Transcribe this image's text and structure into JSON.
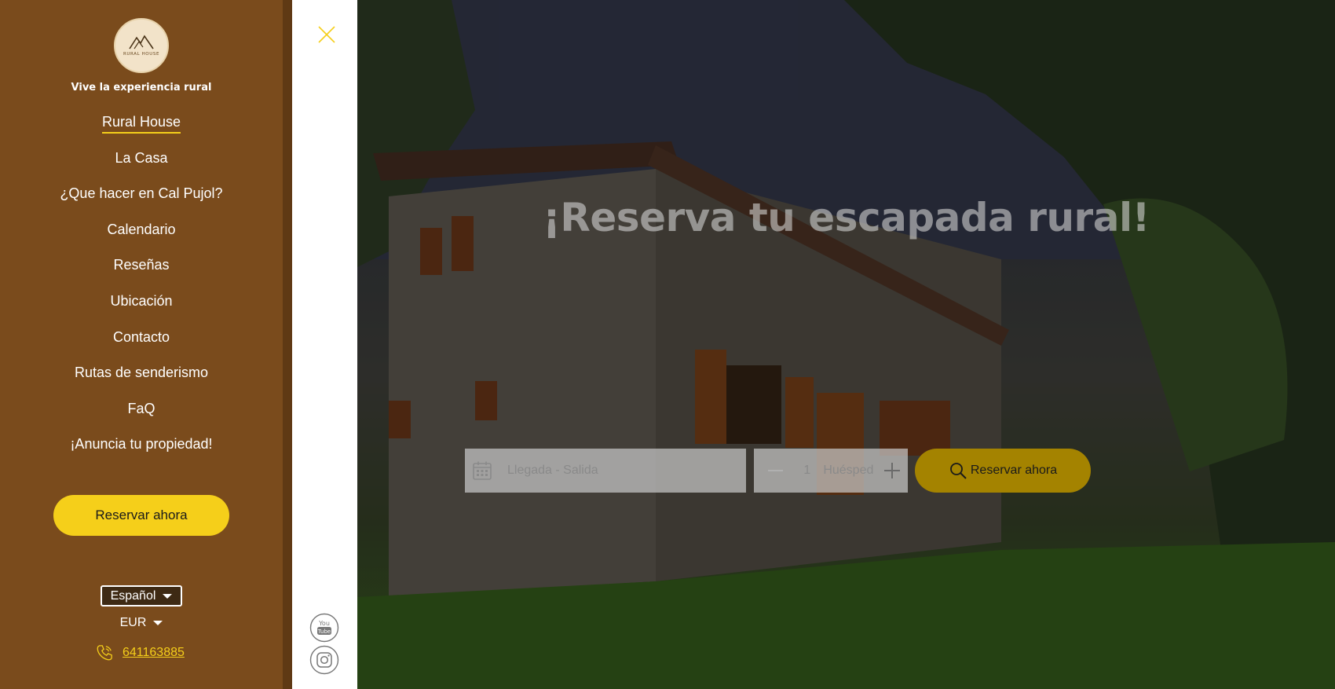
{
  "brand": {
    "logo_text": "RURAL HOUSE",
    "tagline": "Vive la experiencia rural"
  },
  "menu": {
    "items": [
      {
        "label": "Rural House",
        "active": true
      },
      {
        "label": "La Casa"
      },
      {
        "label": "¿Que hacer en Cal Pujol?"
      },
      {
        "label": "Calendario"
      },
      {
        "label": "Reseñas"
      },
      {
        "label": "Ubicación"
      },
      {
        "label": "Contacto"
      },
      {
        "label": "Rutas de senderismo"
      },
      {
        "label": "FaQ"
      },
      {
        "label": "¡Anuncia tu propiedad!"
      }
    ],
    "reserve_label": "Reservar ahora",
    "language": "Español",
    "currency": "EUR",
    "phone": "641163885"
  },
  "hero": {
    "title": "¡Reserva tu escapada rural!",
    "date_placeholder": "Llegada - Salida",
    "guest_count": "1",
    "guest_label": "Huésped",
    "reserve_label": "Reservar ahora"
  },
  "icons": {
    "close": "close-icon",
    "calendar": "calendar-icon",
    "search": "search-icon",
    "phone": "phone-icon",
    "youtube": "youtube-icon",
    "instagram": "instagram-icon"
  },
  "colors": {
    "panel": "#7a4b1c",
    "accent": "#f5cf1a",
    "hero_button": "#a48300"
  }
}
